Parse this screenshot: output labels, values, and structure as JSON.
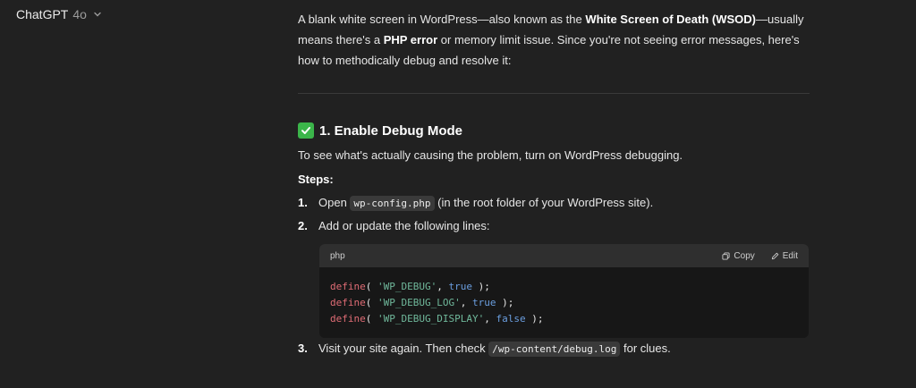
{
  "header": {
    "app_name": "ChatGPT",
    "model": "4o"
  },
  "intro": {
    "t1": "A blank white screen in WordPress—also known as the ",
    "b1": "White Screen of Death (WSOD)",
    "t2": "—usually means there's a ",
    "b2": "PHP error",
    "t3": " or memory limit issue. Since you're not seeing error messages, here's how to methodically debug and resolve it:"
  },
  "section": {
    "title": "1. Enable Debug Mode",
    "line": "To see what's actually causing the problem, turn on WordPress debugging.",
    "steps_label": "Steps:",
    "steps": [
      {
        "num": "1.",
        "pre": "Open ",
        "code": "wp-config.php",
        "post": " (in the root folder of your WordPress site)."
      },
      {
        "num": "2.",
        "pre": "Add or update the following lines:"
      },
      {
        "num": "3.",
        "pre": "Visit your site again. Then check ",
        "code": "/wp-content/debug.log",
        "post": " for clues."
      }
    ]
  },
  "codeblock": {
    "lang": "php",
    "copy_label": "Copy",
    "edit_label": "Edit",
    "lines": [
      {
        "fn": "define",
        "open": "( ",
        "str": "'WP_DEBUG'",
        "comma": ", ",
        "val": "true",
        "close": " );"
      },
      {
        "fn": "define",
        "open": "( ",
        "str": "'WP_DEBUG_LOG'",
        "comma": ", ",
        "val": "true",
        "close": " );"
      },
      {
        "fn": "define",
        "open": "( ",
        "str": "'WP_DEBUG_DISPLAY'",
        "comma": ", ",
        "val": "false",
        "close": " );"
      }
    ]
  }
}
